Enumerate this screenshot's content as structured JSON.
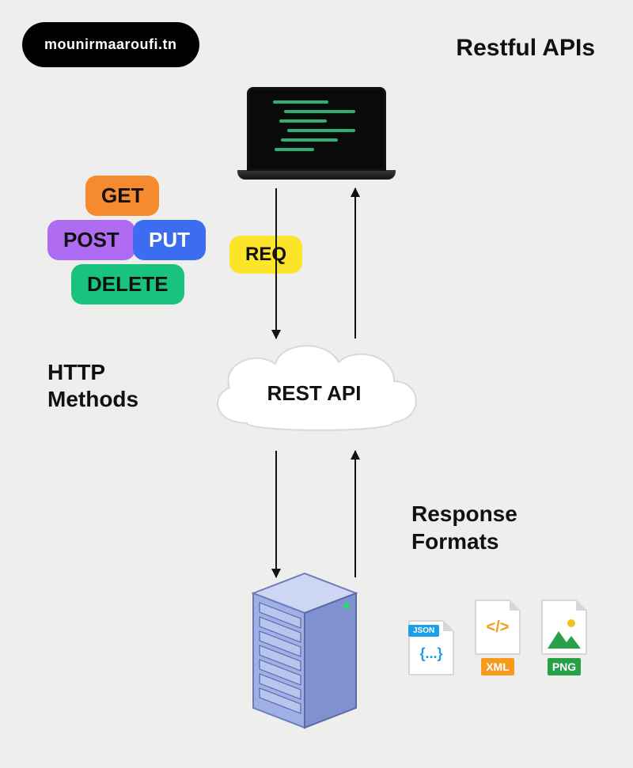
{
  "badge": "mounirmaaroufi.tn",
  "title": "Restful APIs",
  "http_methods": {
    "label_line1": "HTTP",
    "label_line2": "Methods",
    "get": "GET",
    "post": "POST",
    "put": "PUT",
    "delete": "DELETE"
  },
  "request_tag": "REQ",
  "cloud_label": "REST API",
  "response_formats": {
    "label_line1": "Response",
    "label_line2": "Formats",
    "json": {
      "pill": "JSON",
      "braces": "{...}",
      "tag": "JSON"
    },
    "xml": {
      "code": "</>",
      "tag": "XML"
    },
    "png": {
      "tag": "PNG"
    }
  }
}
